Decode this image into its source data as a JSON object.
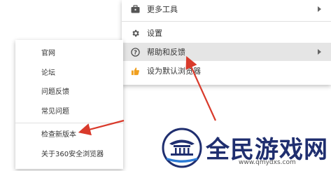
{
  "main_menu": {
    "items": [
      {
        "label": "更多工具",
        "icon": "toolbox-icon"
      },
      {
        "label": "设置",
        "icon": "gear-icon"
      },
      {
        "label": "帮助和反馈",
        "icon": "help-circle-icon"
      },
      {
        "label": "设为默认浏览器",
        "icon": "thumbs-up-icon"
      }
    ]
  },
  "sub_menu": {
    "items": [
      {
        "label": "官网"
      },
      {
        "label": "论坛"
      },
      {
        "label": "问题反馈"
      },
      {
        "label": "常见问题"
      },
      {
        "label": "检查新版本"
      },
      {
        "label": "关于360安全浏览器"
      }
    ]
  },
  "watermark": {
    "name": "全民游戏网",
    "url": "www.qmydxs.com"
  },
  "colors": {
    "arrow": "#d93a2b",
    "hover": "#e5e5e5",
    "logo_blue": "#1f2e6f",
    "thumb": "#f0a020"
  }
}
